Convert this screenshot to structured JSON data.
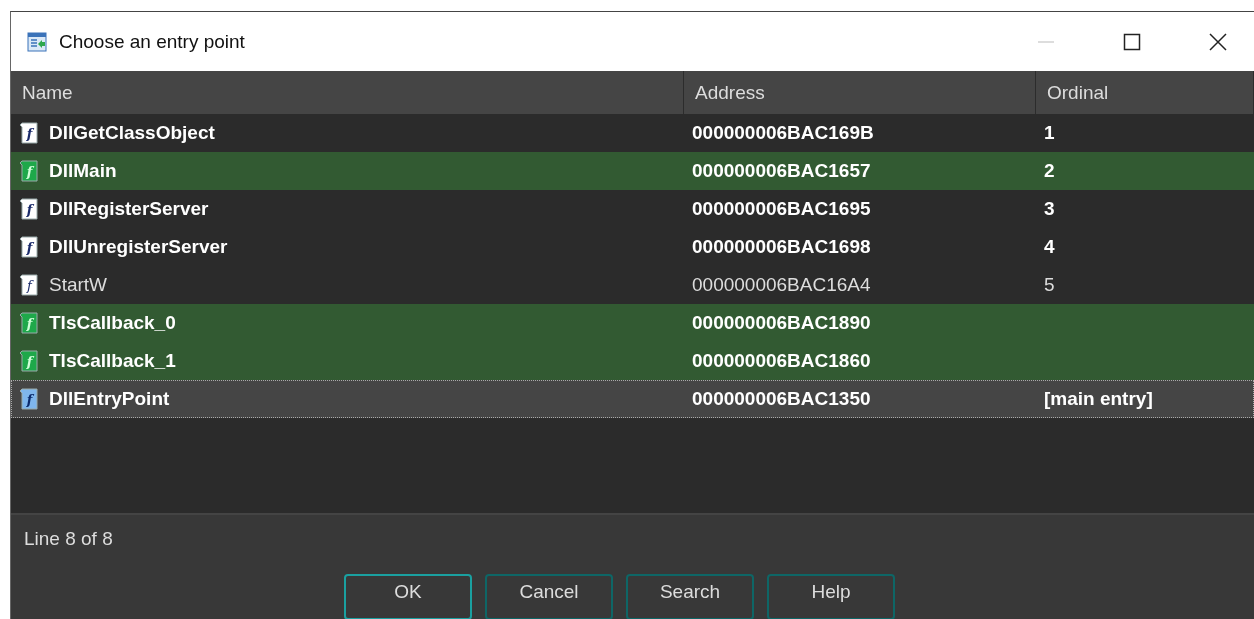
{
  "window": {
    "title": "Choose an entry point"
  },
  "table": {
    "columns": [
      "Name",
      "Address",
      "Ordinal"
    ],
    "rows": [
      {
        "kind": "export",
        "icon": "f",
        "bold": true,
        "selected": false,
        "cells": [
          "DllGetClassObject",
          "000000006BAC169B",
          "1"
        ]
      },
      {
        "kind": "library",
        "icon": "f",
        "bold": true,
        "selected": false,
        "cells": [
          "DllMain",
          "000000006BAC1657",
          "2"
        ]
      },
      {
        "kind": "export",
        "icon": "f",
        "bold": true,
        "selected": false,
        "cells": [
          "DllRegisterServer",
          "000000006BAC1695",
          "3"
        ]
      },
      {
        "kind": "export",
        "icon": "f",
        "bold": true,
        "selected": false,
        "cells": [
          "DllUnregisterServer",
          "000000006BAC1698",
          "4"
        ]
      },
      {
        "kind": "export",
        "icon": "f",
        "bold": false,
        "selected": false,
        "cells": [
          "StartW",
          "000000006BAC16A4",
          "5"
        ]
      },
      {
        "kind": "library",
        "icon": "f",
        "bold": true,
        "selected": false,
        "cells": [
          "TlsCallback_0",
          "000000006BAC1890",
          ""
        ]
      },
      {
        "kind": "library",
        "icon": "f",
        "bold": true,
        "selected": false,
        "cells": [
          "TlsCallback_1",
          "000000006BAC1860",
          ""
        ]
      },
      {
        "kind": "entry",
        "icon": "f",
        "bold": true,
        "selected": true,
        "cells": [
          "DllEntryPoint",
          "000000006BAC1350",
          "[main entry]"
        ]
      }
    ]
  },
  "status_bar": "Line 8 of 8",
  "buttons": [
    {
      "label": "OK",
      "default": true
    },
    {
      "label": "Cancel",
      "default": false
    },
    {
      "label": "Search",
      "default": false
    },
    {
      "label": "Help",
      "default": false
    }
  ]
}
